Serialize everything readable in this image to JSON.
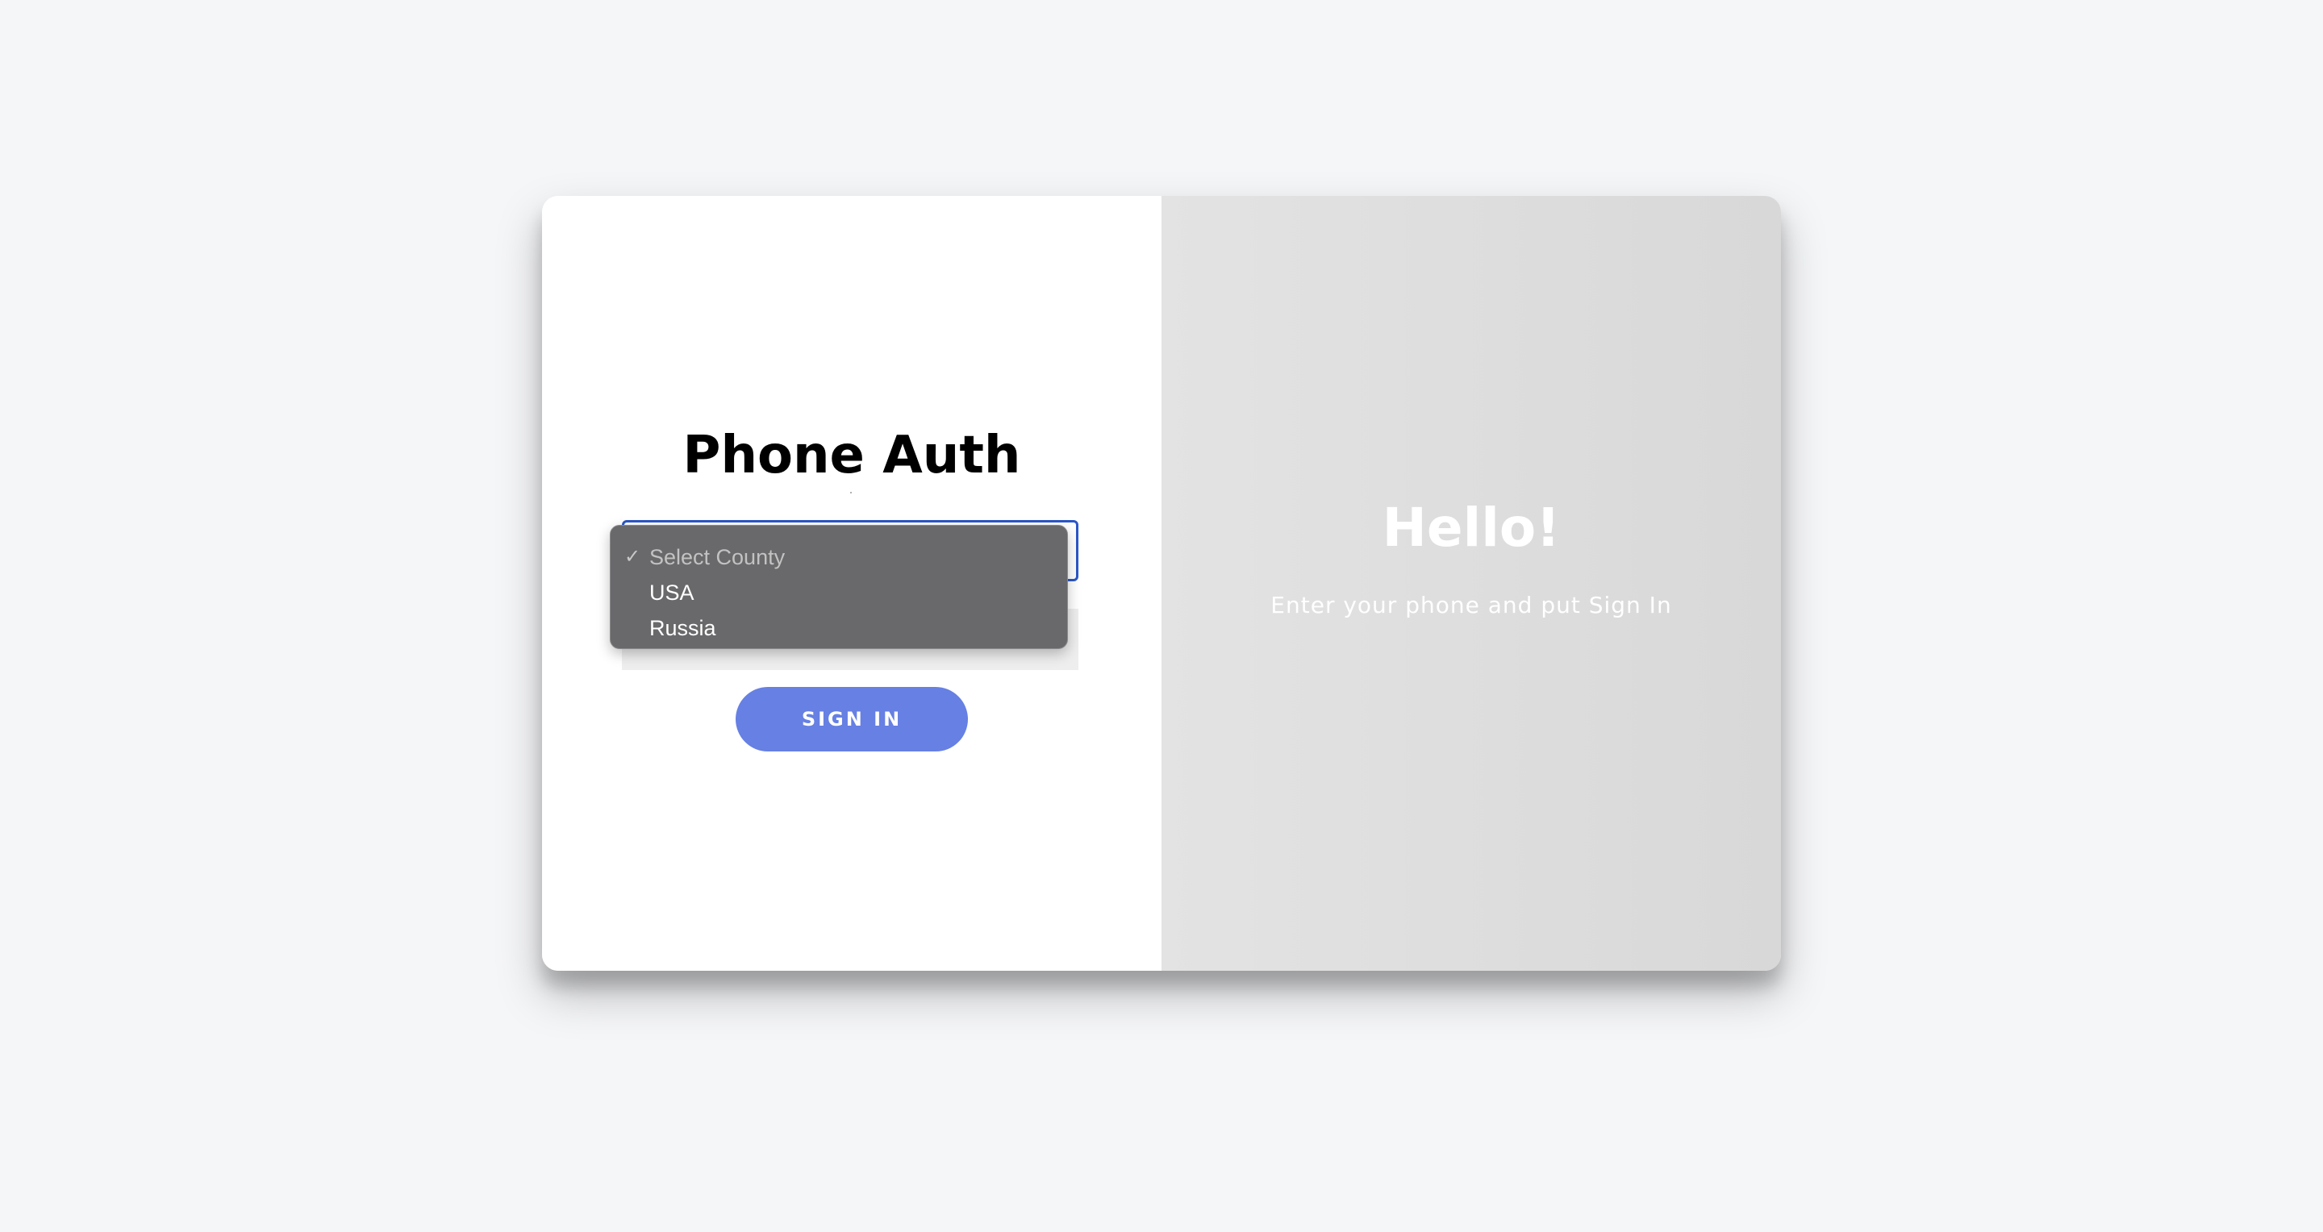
{
  "left_panel": {
    "title": "Phone Auth",
    "country_select": {
      "selected": "Select County",
      "options": [
        "Select County",
        "USA",
        "Russia"
      ]
    },
    "sign_in_label": "SIGN IN"
  },
  "right_panel": {
    "heading": "Hello!",
    "subtitle": "Enter your phone and put Sign In"
  },
  "colors": {
    "page_background": "#f5f6f8",
    "panel_gray": "#dcdcdc",
    "button_blue": "#6680e3",
    "focus_border": "#2b57c7",
    "dropdown_background": "#69696b"
  },
  "icons": {
    "selected_option": "check-icon"
  }
}
